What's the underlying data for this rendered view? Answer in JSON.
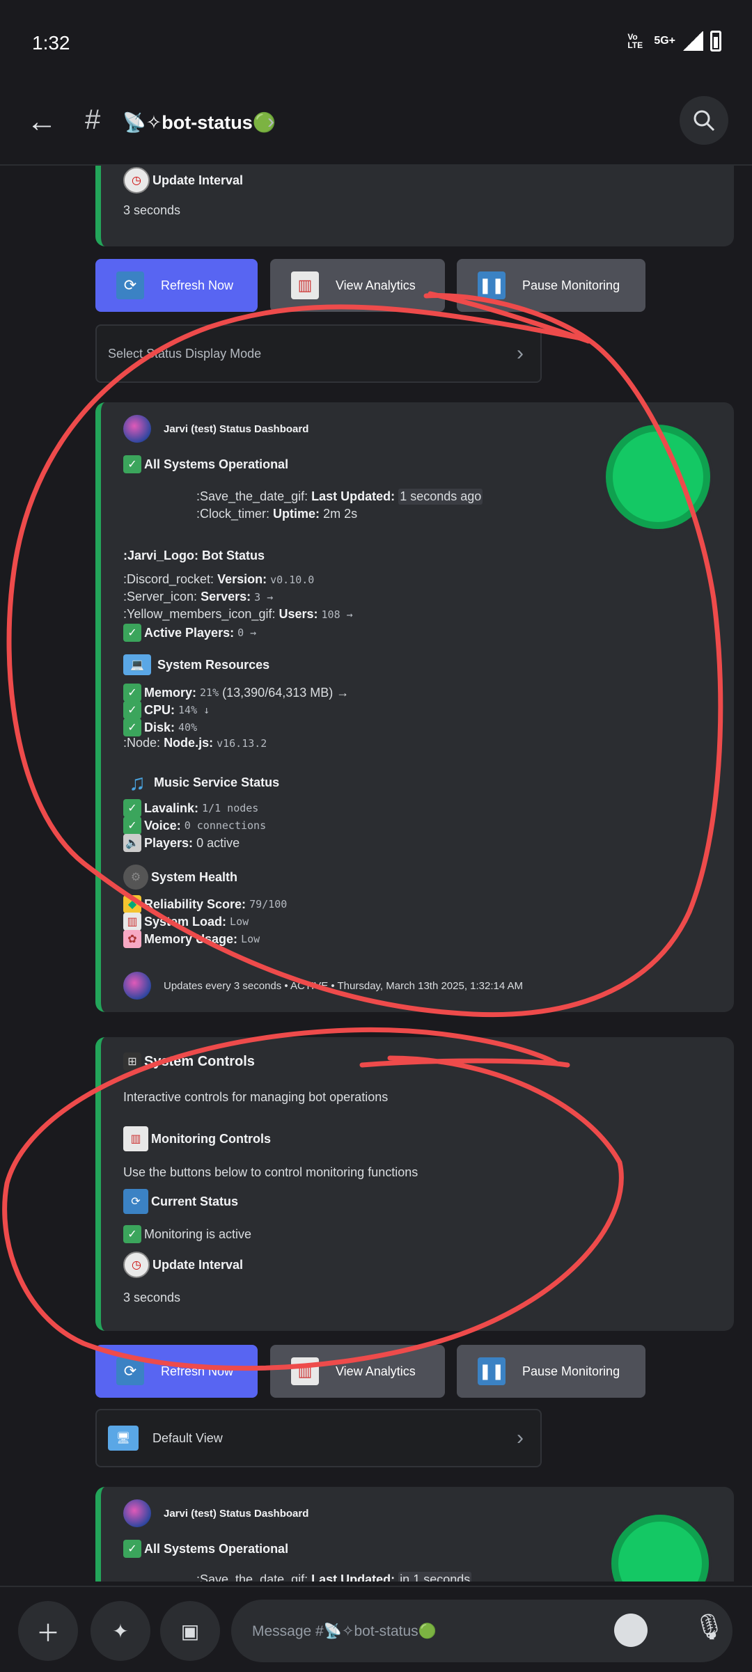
{
  "status_bar": {
    "time": "1:32",
    "network": "5G+",
    "volte": "Vo LTE"
  },
  "header": {
    "channel_name": "📡✧bot-status🟢"
  },
  "embed_top_partial": {
    "update_interval_title": "Update Interval",
    "update_interval_value": "3 seconds"
  },
  "buttons": {
    "refresh": "Refresh Now",
    "analytics": "View Analytics",
    "pause": "Pause Monitoring"
  },
  "select_1": {
    "placeholder": "Select Status Display Mode"
  },
  "dashboard": {
    "author": "Jarvi (test) Status Dashboard",
    "all_systems": "All Systems Operational",
    "last_updated_prefix": ":Save_the_date_gif:",
    "last_updated_label": "Last Updated:",
    "last_updated_value": "1 seconds ago",
    "uptime_prefix": ":Clock_timer:",
    "uptime_label": "Uptime:",
    "uptime_value": "2m 2s",
    "bot_status_title": ":Jarvi_Logo: Bot Status",
    "version_prefix": ":Discord_rocket:",
    "version_label": "Version:",
    "version_value": "v0.10.0",
    "servers_prefix": ":Server_icon:",
    "servers_label": "Servers:",
    "servers_value": "3 →",
    "users_prefix": ":Yellow_members_icon_gif:",
    "users_label": "Users:",
    "users_value": "108 →",
    "active_players_label": "Active Players:",
    "active_players_value": "0 →",
    "resources_title": "System Resources",
    "memory_label": "Memory:",
    "memory_value": "21%",
    "memory_detail": "(13,390/64,313 MB) →",
    "cpu_label": "CPU:",
    "cpu_value": "14% ↓",
    "disk_label": "Disk:",
    "disk_value": "40%",
    "node_prefix": ":Node:",
    "node_label": "Node.js:",
    "node_value": "v16.13.2",
    "music_title": "Music Service Status",
    "lavalink_label": "Lavalink:",
    "lavalink_value": "1/1 nodes",
    "voice_label": "Voice:",
    "voice_value": "0 connections",
    "players_label": "Players:",
    "players_value": "0 active",
    "health_title": "System Health",
    "reliability_label": "Reliability Score:",
    "reliability_value": "79/100",
    "load_label": "System Load:",
    "load_value": "Low",
    "memusage_label": "Memory Usage:",
    "memusage_value": "Low",
    "footer": "Updates every 3 seconds • ACTIVE • Thursday, March 13th 2025, 1:32:14 AM"
  },
  "controls": {
    "title": "System Controls",
    "description": "Interactive controls for managing bot operations",
    "monitoring_title": "Monitoring Controls",
    "monitoring_desc": "Use the buttons below to control monitoring functions",
    "current_status_title": "Current Status",
    "current_status_value": "Monitoring is active",
    "update_interval_title": "Update Interval",
    "update_interval_value": "3 seconds"
  },
  "select_2": {
    "value": "Default View"
  },
  "dashboard_2": {
    "author": "Jarvi (test) Status Dashboard",
    "all_systems": "All Systems Operational",
    "last_updated_prefix": ":Save_the_date_gif:",
    "last_updated_label": "Last Updated:",
    "last_updated_value": "in 1 seconds"
  },
  "composer": {
    "placeholder": "Message #📡✧bot-status🟢"
  },
  "colors": {
    "accent": "#5865f2",
    "embed_bar": "#23a55a",
    "annotation": "#ee4b4b"
  }
}
